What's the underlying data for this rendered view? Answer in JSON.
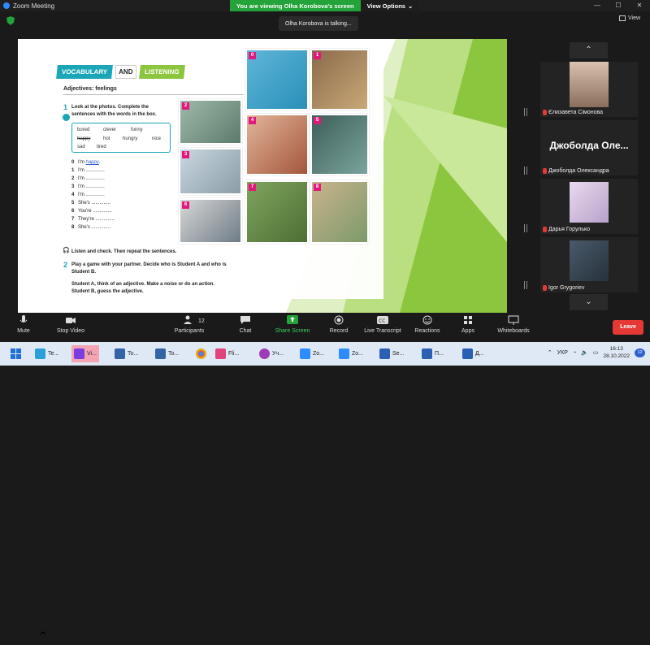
{
  "window": {
    "title": "Zoom Meeting"
  },
  "banner": {
    "viewing": "You are viewing Olha Korobova's screen",
    "view_options": "View Options"
  },
  "talking": "Olha Korobova is talking...",
  "view_button": "View",
  "slide": {
    "section_left": "VOCABULARY",
    "section_and": "AND",
    "section_right": "LISTENING",
    "subtitle": "Adjectives: feelings",
    "ex1_num": "1",
    "ex1_text_a": "Look at the photos. Complete the",
    "ex1_text_b": "sentences with the words in the box.",
    "words": [
      "bored",
      "clever",
      "funny",
      "happy",
      "hot",
      "hungry",
      "nice",
      "sad",
      "tired"
    ],
    "sentences": [
      {
        "n": "0",
        "text": "I'm ",
        "answer": "happy",
        "end": "."
      },
      {
        "n": "1",
        "text": "I'm ..............",
        "answer": "",
        "end": ""
      },
      {
        "n": "2",
        "text": "I'm ..............",
        "answer": "",
        "end": ""
      },
      {
        "n": "3",
        "text": "I'm ..............",
        "answer": "",
        "end": ""
      },
      {
        "n": "4",
        "text": "I'm ..............",
        "answer": "",
        "end": ""
      },
      {
        "n": "5",
        "text": "She's ..............",
        "answer": "",
        "end": ""
      },
      {
        "n": "6",
        "text": "You're ..............",
        "answer": "",
        "end": ""
      },
      {
        "n": "7",
        "text": "They're ..............",
        "answer": "",
        "end": ""
      },
      {
        "n": "8",
        "text": "She's ..............",
        "answer": "",
        "end": ""
      }
    ],
    "listen_text": "Listen and check. Then repeat the sentences.",
    "ex2_num": "2",
    "ex2_text_a": "Play a game with your partner. Decide who is Student A and who is",
    "ex2_text_b": "Student B.",
    "ex2_text_c": "Student A, think of an adjective. Make a noise or do an action.",
    "ex2_text_d": "Student B, guess the adjective.",
    "photo_tags": [
      "0",
      "1",
      "2",
      "3",
      "4",
      "5",
      "6",
      "7",
      "8"
    ]
  },
  "participants": [
    {
      "name": "Єлизавета Сімонова"
    },
    {
      "name": "Джоболда Олександра",
      "big": "Джоболда  Оле..."
    },
    {
      "name": "Дарья Горулько"
    },
    {
      "name": "Igor Grygoriev"
    }
  ],
  "toolbar": {
    "mute": "Mute",
    "stop_video": "Stop Video",
    "participants": "Participants",
    "participants_count": "12",
    "chat": "Chat",
    "share_screen": "Share Screen",
    "record": "Record",
    "live_transcript": "Live Transcript",
    "reactions": "Reactions",
    "apps": "Apps",
    "whiteboards": "Whiteboards",
    "leave": "Leave"
  },
  "taskbar": {
    "items": [
      "Te...",
      "Vi...",
      "To...",
      "To...",
      "",
      "Fli...",
      "Уч...",
      "Zo...",
      "Zo...",
      "Se...",
      "П...",
      "Д..."
    ],
    "lang": "УКР",
    "time": "16:13",
    "date": "28.10.2022",
    "notifications": "12"
  },
  "colors": {
    "accent_teal": "#1aa6b7",
    "accent_green": "#8cc63f",
    "zoom_green": "#23a33a",
    "leave_red": "#e53935"
  }
}
